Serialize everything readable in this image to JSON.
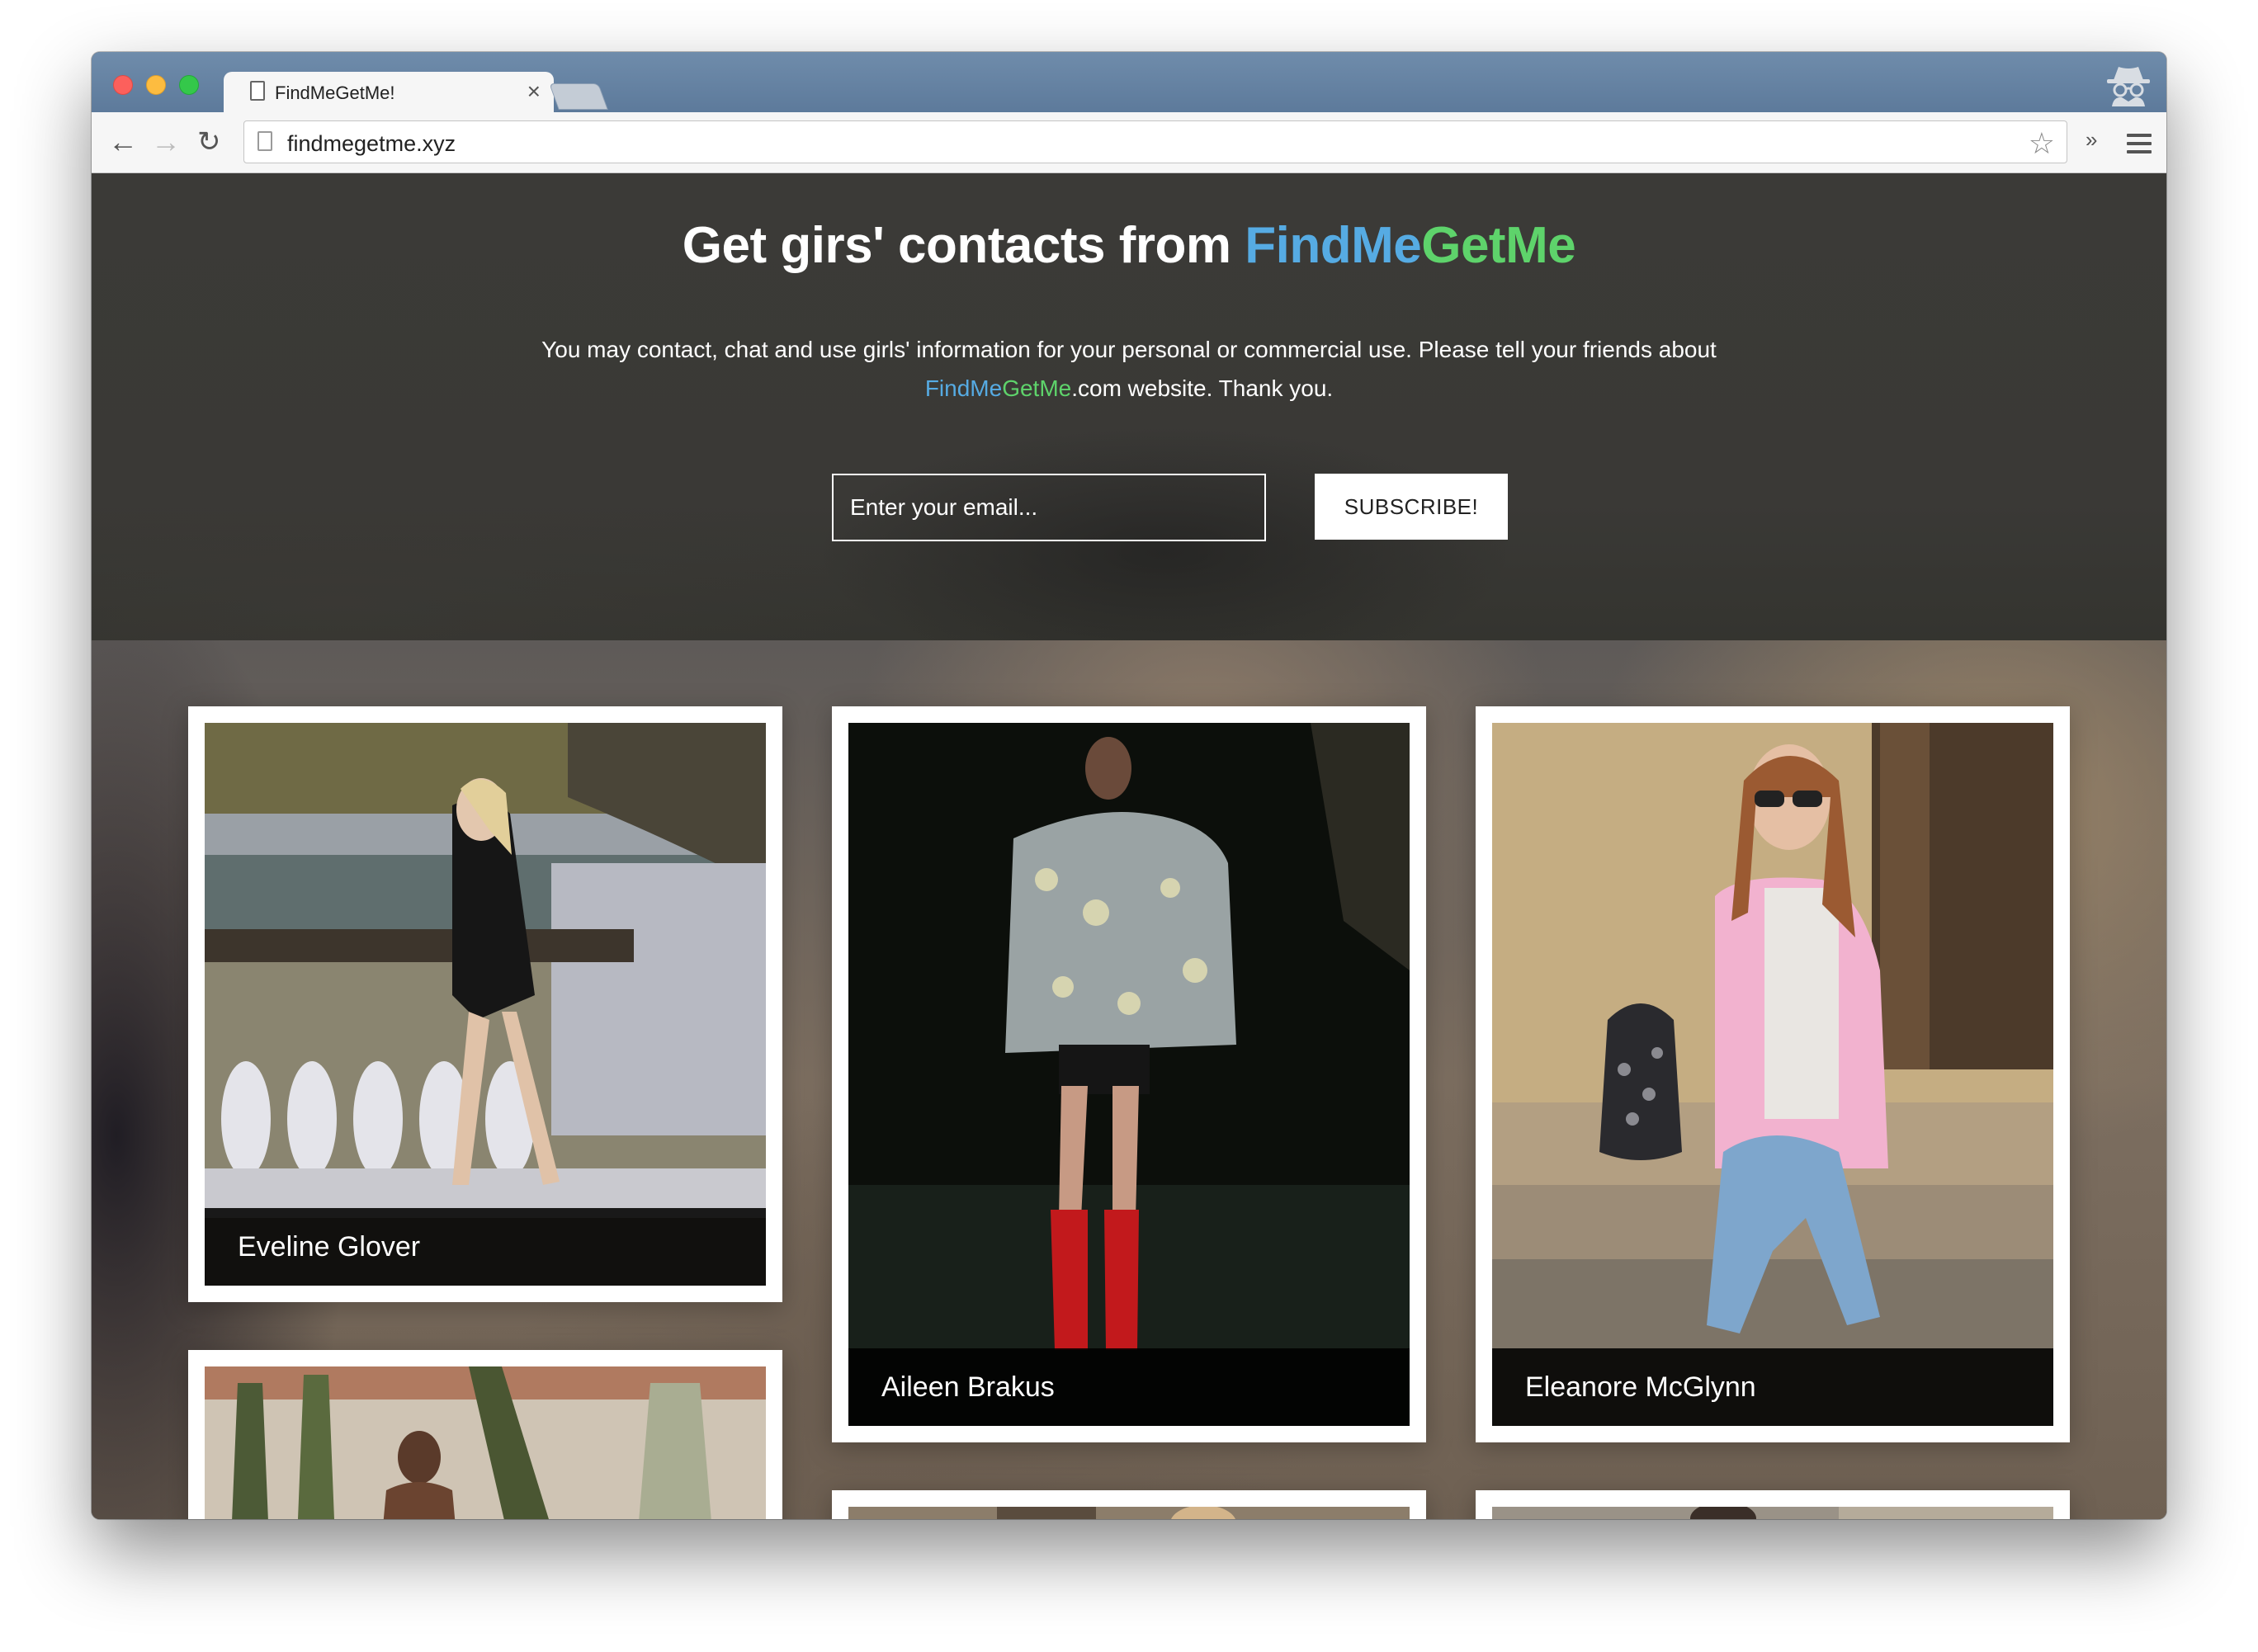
{
  "browser": {
    "tab_title": "FindMeGetMe!",
    "tab_close": "×",
    "url": "findmegetme.xyz",
    "icons": [
      "document-icon",
      "back-arrow-icon",
      "forward-arrow-icon",
      "reload-icon",
      "star-icon",
      "extensions-chevron-icon",
      "hamburger-menu-icon",
      "incognito-icon"
    ],
    "back_glyph": "←",
    "forward_glyph": "→",
    "reload_glyph": "↻",
    "star_glyph": "☆",
    "more_glyph": "»"
  },
  "hero": {
    "title_prefix": "Get girs' contacts from ",
    "brand_part1": "FindMe",
    "brand_part2": "GetMe",
    "description_line1": "You may contact, chat and use girls' information for your personal or commercial use. Please tell your friends about",
    "description_brand1": "FindMe",
    "description_brand2": "GetMe",
    "description_suffix": ".com website. Thank you.",
    "email_placeholder": "Enter your email...",
    "subscribe_label": "SUBSCRIBE!",
    "colors": {
      "brand_blue": "#56abe3",
      "brand_green": "#5ed36b"
    }
  },
  "gallery": {
    "cards": [
      {
        "name": "Eveline Glover"
      },
      {
        "name": "Aileen Brakus"
      },
      {
        "name": "Eleanore McGlynn"
      }
    ]
  }
}
